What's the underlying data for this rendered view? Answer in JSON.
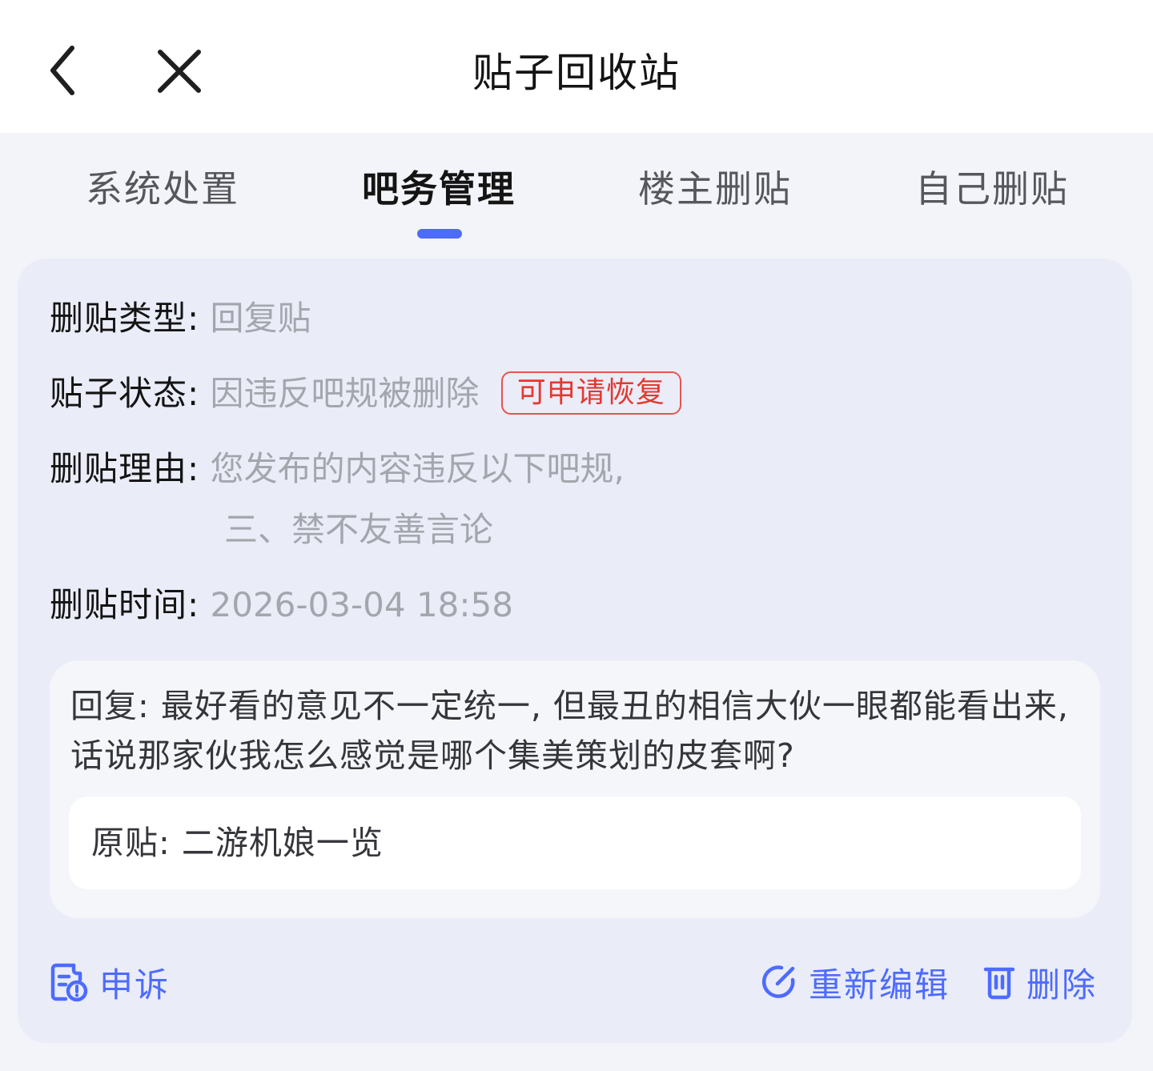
{
  "header": {
    "title": "贴子回收站"
  },
  "tabs": [
    {
      "label": "系统处置",
      "active": false
    },
    {
      "label": "吧务管理",
      "active": true
    },
    {
      "label": "楼主删贴",
      "active": false
    },
    {
      "label": "自己删贴",
      "active": false
    }
  ],
  "record": {
    "delete_type_label": "删贴类型:",
    "delete_type_value": "回复贴",
    "status_label": "贴子状态:",
    "status_value": "因违反吧规被删除",
    "status_badge": "可申请恢复",
    "reason_label": "删贴理由:",
    "reason_line1": "您发布的内容违反以下吧规,",
    "reason_line2": "三、禁不友善言论",
    "time_label": "删贴时间:",
    "time_value": "2026-03-04 18:58",
    "reply_text": "回复: 最好看的意见不一定统一, 但最丑的相信大伙一眼都能看出来, 话说那家伙我怎么感觉是哪个集美策划的皮套啊?",
    "original_post": "原贴: 二游机娘一览"
  },
  "actions": {
    "appeal_label": "申诉",
    "reedit_label": "重新编辑",
    "delete_label": "删除"
  },
  "colors": {
    "accent": "#4d6bfe",
    "badge_red": "#e4382f",
    "card_bg": "#eaecf8",
    "page_bg": "#f3f4f9"
  },
  "icons": {
    "back": "chevron-left-icon",
    "close": "close-icon",
    "appeal": "appeal-doc-icon",
    "edit": "edit-icon",
    "delete": "trash-icon"
  }
}
